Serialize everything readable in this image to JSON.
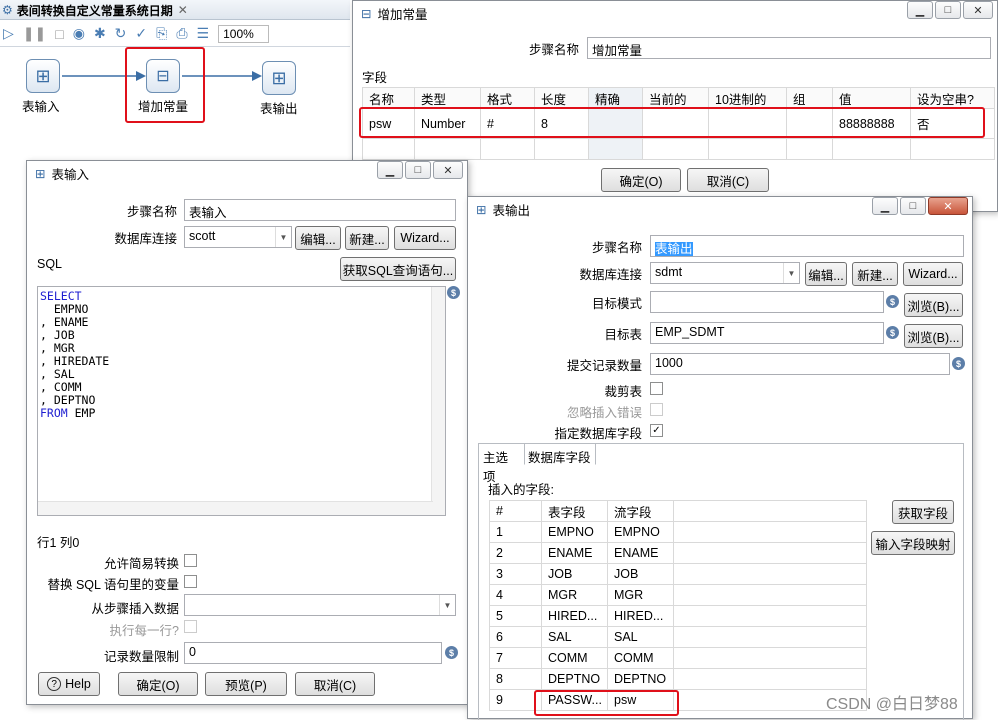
{
  "editor": {
    "tab_title": "表间转换自定义常量系统日期",
    "zoom": "100%"
  },
  "canvas": {
    "steps": [
      {
        "label": "表输入"
      },
      {
        "label": "增加常量"
      },
      {
        "label": "表输出"
      }
    ]
  },
  "const_dialog": {
    "title": "增加常量",
    "step_name_label": "步骤名称",
    "step_name": "增加常量",
    "fields_label": "字段",
    "columns": [
      "名称",
      "类型",
      "格式",
      "长度",
      "精确",
      "当前的",
      "10进制的",
      "组",
      "值",
      "设为空串?"
    ],
    "rows": [
      [
        "psw",
        "Number",
        "#",
        "8",
        "",
        "",
        "",
        "",
        "88888888",
        "否"
      ]
    ],
    "ok": "确定(O)",
    "cancel": "取消(C)"
  },
  "input_dialog": {
    "title": "表输入",
    "step_name_label": "步骤名称",
    "step_name": "表输入",
    "db_label": "数据库连接",
    "db": "scott",
    "edit": "编辑...",
    "new": "新建...",
    "wizard": "Wizard...",
    "sql_label": "SQL",
    "get_sql": "获取SQL查询语句...",
    "sql_lines": [
      {
        "kw": "SELECT",
        "rest": ""
      },
      {
        "kw": "",
        "rest": "  EMPNO"
      },
      {
        "kw": "",
        "rest": ", ENAME"
      },
      {
        "kw": "",
        "rest": ", JOB"
      },
      {
        "kw": "",
        "rest": ", MGR"
      },
      {
        "kw": "",
        "rest": ", HIREDATE"
      },
      {
        "kw": "",
        "rest": ", SAL"
      },
      {
        "kw": "",
        "rest": ", COMM"
      },
      {
        "kw": "",
        "rest": ", DEPTNO"
      },
      {
        "kw": "FROM",
        "rest": " EMP"
      }
    ],
    "position": "行1 列0",
    "lazy": "允许简易转换",
    "replace_vars": "替换 SQL 语句里的变量",
    "insert_from": "从步骤插入数据",
    "each_row": "执行每一行?",
    "limit_label": "记录数量限制",
    "limit": "0",
    "help": "Help",
    "ok": "确定(O)",
    "preview": "预览(P)",
    "cancel": "取消(C)"
  },
  "output_dialog": {
    "title": "表输出",
    "step_name_label": "步骤名称",
    "step_name": "表输出",
    "db_label": "数据库连接",
    "db": "sdmt",
    "edit": "编辑...",
    "new": "新建...",
    "wizard": "Wizard...",
    "schema_label": "目标模式",
    "schema": "",
    "browse": "浏览(B)...",
    "table_label": "目标表",
    "table": "EMP_SDMT",
    "commit_label": "提交记录数量",
    "commit": "1000",
    "truncate": "裁剪表",
    "ignore_errors": "忽略插入错误",
    "specify_fields": "指定数据库字段",
    "tabs": [
      "主选项",
      "数据库字段"
    ],
    "insert_fields_label": "插入的字段:",
    "columns": [
      "#",
      "表字段",
      "流字段"
    ],
    "rows": [
      [
        "1",
        "EMPNO",
        "EMPNO"
      ],
      [
        "2",
        "ENAME",
        "ENAME"
      ],
      [
        "3",
        "JOB",
        "JOB"
      ],
      [
        "4",
        "MGR",
        "MGR"
      ],
      [
        "5",
        "HIRED...",
        "HIRED..."
      ],
      [
        "6",
        "SAL",
        "SAL"
      ],
      [
        "7",
        "COMM",
        "COMM"
      ],
      [
        "8",
        "DEPTNO",
        "DEPTNO"
      ],
      [
        "9",
        "PASSW...",
        "psw"
      ]
    ],
    "get_fields": "获取字段",
    "map_fields": "输入字段映射"
  },
  "watermark": "CSDN @白日梦88"
}
